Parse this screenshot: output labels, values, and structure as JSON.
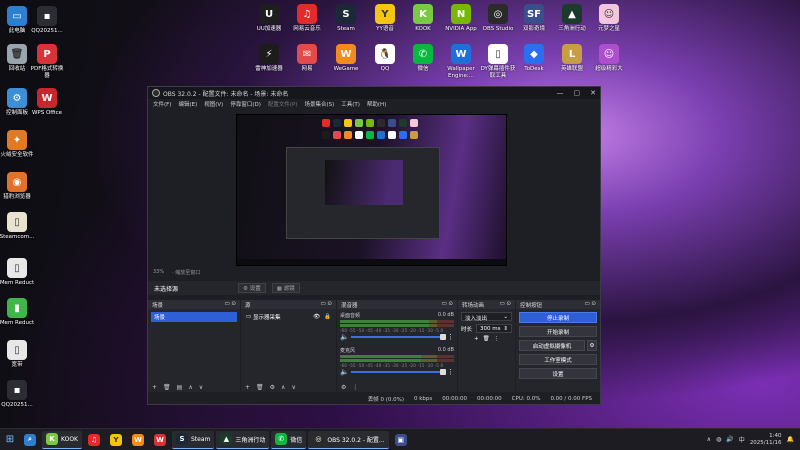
{
  "desktop": {
    "left_column": [
      {
        "label": "此电脑",
        "color": "#2d7fd0",
        "glyph": "▭"
      },
      {
        "label": "回收站",
        "color": "#9aa4ad",
        "glyph": "🗑"
      },
      {
        "label": "控制面板",
        "color": "#3a8fd6",
        "glyph": "⚙"
      },
      {
        "label": "火绒安全软件",
        "color": "#e07b23",
        "glyph": "✦"
      },
      {
        "label": "猎豹浏览器",
        "color": "#e0722a",
        "glyph": "◉"
      },
      {
        "label": "Steamcom...",
        "color": "#e8e2cf",
        "glyph": "▯"
      },
      {
        "label": "Mem Reduct",
        "color": "#e8e8e8",
        "glyph": "▯"
      },
      {
        "label": "Mem Reduct",
        "color": "#3fb54a",
        "glyph": "▮"
      },
      {
        "label": "宽带",
        "color": "#e8e8e8",
        "glyph": "▯"
      },
      {
        "label": "QQ20251...",
        "color": "#2c2c34",
        "glyph": "▪"
      }
    ],
    "second_column": [
      {
        "label": "QQ20251...",
        "color": "#2c2c34",
        "glyph": "▪"
      },
      {
        "label": "PDF格式转换器",
        "color": "#d9333a",
        "glyph": "P"
      },
      {
        "label": "WPS Office",
        "color": "#c7262c",
        "glyph": "W"
      }
    ],
    "top_row": [
      {
        "label": "UU加速器",
        "color": "#1e1e1e",
        "glyph": "U"
      },
      {
        "label": "网易云音乐",
        "color": "#e22b2b",
        "glyph": "♫"
      },
      {
        "label": "Steam",
        "color": "#1b2838",
        "glyph": "S"
      },
      {
        "label": "YY语音",
        "color": "#f4c613",
        "glyph": "Y"
      },
      {
        "label": "KOOK",
        "color": "#7ac943",
        "glyph": "K"
      },
      {
        "label": "NVIDIA App",
        "color": "#76b900",
        "glyph": "N"
      },
      {
        "label": "OBS Studio",
        "color": "#2b2b2b",
        "glyph": "◎"
      },
      {
        "label": "双影奇境",
        "color": "#3a4e8c",
        "glyph": "SF"
      },
      {
        "label": "三角洲行动",
        "color": "#1d3b2a",
        "glyph": "▲"
      },
      {
        "label": "元梦之星",
        "color": "#f3c6dd",
        "glyph": "☺"
      }
    ],
    "second_row": [
      {
        "label": "雷神加速器",
        "color": "#1c1c1c",
        "glyph": "⚡"
      },
      {
        "label": "网易",
        "color": "#e34b4b",
        "glyph": "✉"
      },
      {
        "label": "WeGame",
        "color": "#f28a1d",
        "glyph": "W"
      },
      {
        "label": "QQ",
        "color": "#ffffff",
        "glyph": "🐧"
      },
      {
        "label": "微信",
        "color": "#09b83e",
        "glyph": "✆"
      },
      {
        "label": "Wallpaper Engine:...",
        "color": "#1e6fd9",
        "glyph": "W"
      },
      {
        "label": "DY弹幕插件获取工具",
        "color": "#ffffff",
        "glyph": "▯"
      },
      {
        "label": "ToDesk",
        "color": "#2a6ef2",
        "glyph": "◆"
      },
      {
        "label": "英雄联盟",
        "color": "#c79d45",
        "glyph": "L"
      },
      {
        "label": "超级精彩大",
        "color": "#ae4fd0",
        "glyph": "☺"
      }
    ]
  },
  "obs": {
    "title": "OBS 32.0.2 - 配置文件: 未命名 - 场景: 未命名",
    "window_controls": [
      "—",
      "▢",
      "✕"
    ],
    "menu": [
      {
        "label": "文件(F)",
        "dim": false
      },
      {
        "label": "编辑(E)",
        "dim": false
      },
      {
        "label": "视图(V)",
        "dim": false
      },
      {
        "label": "停靠窗口(D)",
        "dim": false
      },
      {
        "label": "配置文件(P)",
        "dim": true
      },
      {
        "label": "场景集合(S)",
        "dim": false
      },
      {
        "label": "工具(T)",
        "dim": false
      },
      {
        "label": "帮助(H)",
        "dim": false
      }
    ],
    "zoom": {
      "text": "33%",
      "scale_text": "· 缩放至窗口"
    },
    "source_toolbar": {
      "label": "未选择源",
      "buttons": [
        "⚙ 设置",
        "▦ 滤镜"
      ]
    },
    "docks": {
      "scenes": {
        "title": "场景",
        "items": [
          "场景"
        ],
        "footer": [
          "+",
          "🗑",
          "▤",
          "∧",
          "∨"
        ]
      },
      "sources": {
        "title": "源",
        "items": [
          {
            "label": "显示器采集",
            "eye": "👁",
            "lock": "🔒"
          }
        ],
        "footer": [
          "+",
          "🗑",
          "⚙",
          "∧",
          "∨"
        ]
      },
      "mixer": {
        "title": "混音器",
        "tracks": [
          {
            "name": "桌面音频",
            "db": "0.0 dB",
            "level": 0.78,
            "volume": 1.0
          },
          {
            "name": "麦克风",
            "db": "0.0 dB",
            "level": 0.71,
            "volume": 1.0
          }
        ],
        "scale": "-60 -55 -50 -45 -40 -35 -30 -25 -20 -15 -10 -5 0",
        "footer": [
          "⚙",
          "⋮"
        ]
      },
      "transitions": {
        "title": "转场动画",
        "type": "淡入淡出",
        "duration_label": "时长",
        "duration": "300 ms",
        "footer": [
          "+",
          "🗑",
          "⋮"
        ]
      },
      "controls": {
        "title": "控制按钮",
        "buttons": [
          {
            "label": "停止录制",
            "active": true
          },
          {
            "label": "开始录制",
            "active": false
          },
          {
            "label": "启动虚拟摄像机",
            "active": false
          },
          {
            "label": "工作室模式",
            "active": false
          },
          {
            "label": "设置",
            "active": false
          }
        ]
      }
    },
    "status": {
      "frames": "丢帧 0 (0.0%)",
      "bitrate": "0 kbps",
      "stream_time": "00:00:00",
      "rec_time": "00:00:00",
      "cpu": "CPU: 0.0%",
      "fps": "0.00 / 0.00 FPS"
    }
  },
  "taskbar": {
    "items": [
      {
        "label": "",
        "color": "#2d7fd0",
        "glyph": "⌕",
        "running": false
      },
      {
        "label": "KOOK",
        "color": "#7ac943",
        "glyph": "K",
        "running": true
      },
      {
        "label": "",
        "color": "#e22b2b",
        "glyph": "♫",
        "running": false
      },
      {
        "label": "",
        "color": "#f4c613",
        "glyph": "Y",
        "running": false
      },
      {
        "label": "",
        "color": "#f28a1d",
        "glyph": "W",
        "running": false
      },
      {
        "label": "",
        "color": "#d9333a",
        "glyph": "W",
        "running": false
      },
      {
        "label": "Steam",
        "color": "#1b2838",
        "glyph": "S",
        "running": true
      },
      {
        "label": "三角洲行动",
        "color": "#1d3b2a",
        "glyph": "▲",
        "running": true
      },
      {
        "label": "微信",
        "color": "#09b83e",
        "glyph": "✆",
        "running": true
      },
      {
        "label": "OBS 32.0.2 - 配置...",
        "color": "#2b2b2b",
        "glyph": "◎",
        "running": true
      },
      {
        "label": "",
        "color": "#3a4e8c",
        "glyph": "▣",
        "running": false
      }
    ],
    "tray": {
      "input": "中",
      "time": "1:40",
      "date": "2025/11/16"
    }
  }
}
